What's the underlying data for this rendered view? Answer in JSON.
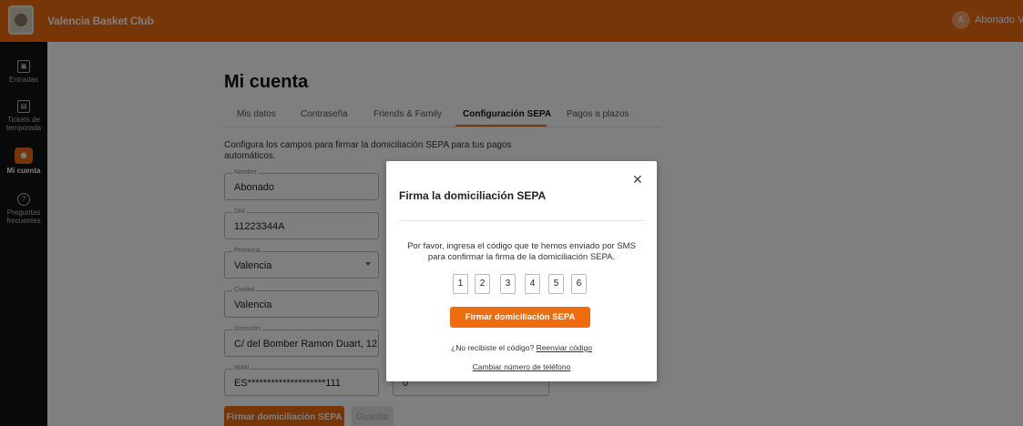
{
  "header": {
    "club_name": "Valencia Basket Club",
    "avatar_initial": "A",
    "user_name": "Abonado VB"
  },
  "sidebar": {
    "items": [
      {
        "label": "Entradas",
        "icon": "ticket-icon"
      },
      {
        "label": "Tickets de temporada",
        "icon": "season-ticket-icon"
      },
      {
        "label": "Mi cuenta",
        "icon": "account-icon",
        "active": true
      },
      {
        "label": "Preguntas frecuentes",
        "icon": "help-icon"
      }
    ]
  },
  "page": {
    "title": "Mi cuenta",
    "tabs": [
      "Mis datos",
      "Contraseña",
      "Friends & Family",
      "Configuración SEPA",
      "Pagos a plazos"
    ],
    "active_tab": "Configuración SEPA",
    "description": "Configura los campos para firmar la domiciliación SEPA para tus pagos automáticos.",
    "fields": {
      "nombre": {
        "label": "Nombre",
        "value": "Abonado"
      },
      "dni": {
        "label": "DNI",
        "value": "11223344A"
      },
      "provincia": {
        "label": "Provincia",
        "value": "Valencia"
      },
      "ciudad": {
        "label": "Ciudad",
        "value": "Valencia"
      },
      "direccion": {
        "label": "Dirección",
        "value": "C/ del Bomber Ramon Duart, 12"
      },
      "iban": {
        "label": "IBAN",
        "value": "ES********************111"
      },
      "right_field_value": "0"
    },
    "sign_button": "Firmar domiciliación SEPA",
    "save_button": "Guardar"
  },
  "modal": {
    "title": "Firma la domiciliación SEPA",
    "message": "Por favor, ingresa el código que te hemos enviado por SMS para confirmar la firma de la domiciliación SEPA.",
    "otp": [
      "1",
      "2",
      "3",
      "4",
      "5",
      "6"
    ],
    "confirm_button": "Firmar domiciliación SEPA",
    "resend_prompt": "¿No recibiste el código?",
    "resend_link": "Reenviar código",
    "change_phone": "Cambiar número de teléfono"
  },
  "colors": {
    "accent": "#ef6c0e",
    "sidebar": "#121212"
  }
}
